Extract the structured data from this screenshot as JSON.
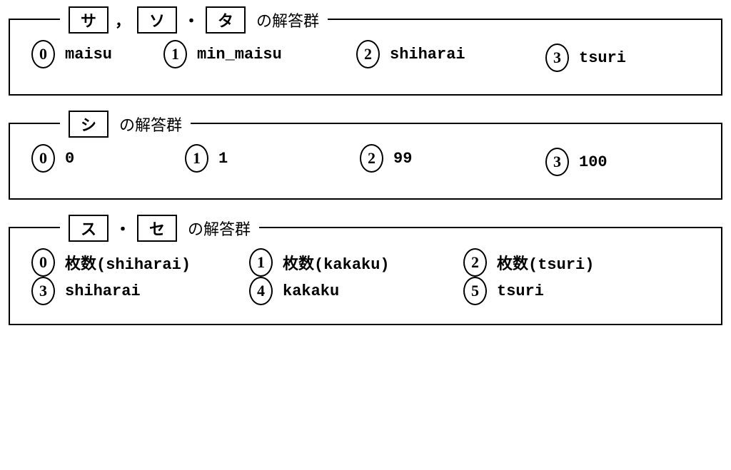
{
  "legend_suffix": "の解答群",
  "groups": [
    {
      "id": "g1",
      "labels": [
        "サ",
        "ソ",
        "タ"
      ],
      "seps": [
        "，",
        "・"
      ],
      "options": [
        {
          "num": "0",
          "text": "maisu"
        },
        {
          "num": "1",
          "text": "min_maisu"
        },
        {
          "num": "2",
          "text": "shiharai"
        },
        {
          "num": "3",
          "text": "tsuri"
        }
      ]
    },
    {
      "id": "g2",
      "labels": [
        "シ"
      ],
      "seps": [],
      "options": [
        {
          "num": "0",
          "text": "0"
        },
        {
          "num": "1",
          "text": "1"
        },
        {
          "num": "2",
          "text": "99"
        },
        {
          "num": "3",
          "text": "100"
        }
      ]
    },
    {
      "id": "g3",
      "labels": [
        "ス",
        "セ"
      ],
      "seps": [
        "・"
      ],
      "options": [
        {
          "num": "0",
          "jp": "枚数",
          "text": "(shiharai)"
        },
        {
          "num": "1",
          "jp": "枚数",
          "text": "(kakaku)"
        },
        {
          "num": "2",
          "jp": "枚数",
          "text": "(tsuri)"
        },
        {
          "num": "3",
          "text": "shiharai"
        },
        {
          "num": "4",
          "text": "kakaku"
        },
        {
          "num": "5",
          "text": "tsuri"
        }
      ]
    }
  ]
}
